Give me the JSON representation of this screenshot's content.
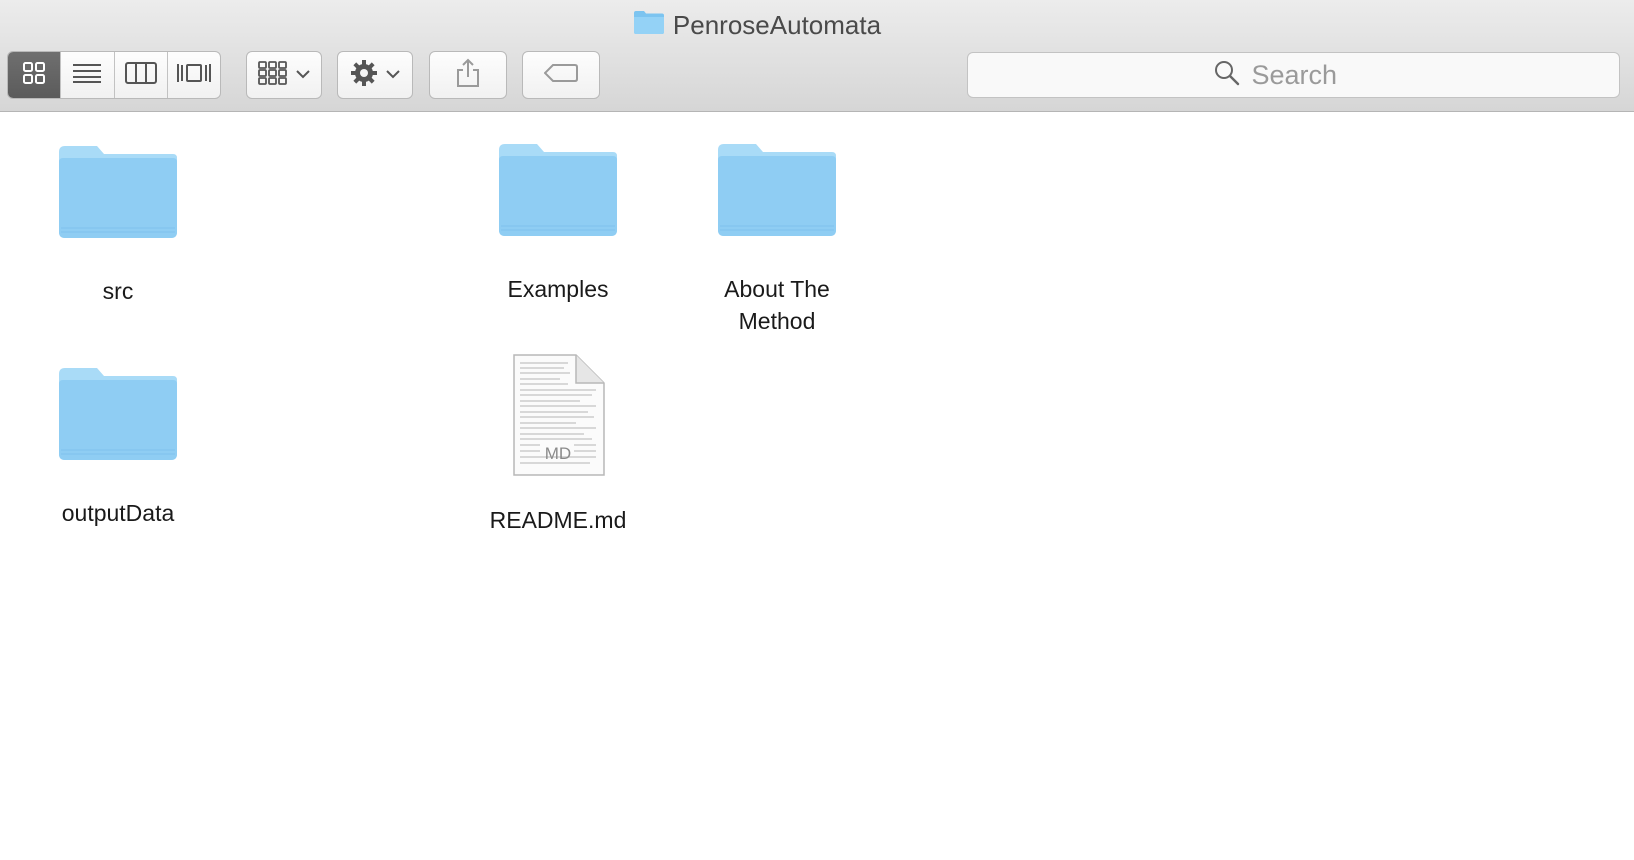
{
  "window": {
    "title": "PenroseAutomata"
  },
  "toolbar": {
    "view_modes": [
      {
        "name": "icon-view",
        "active": true
      },
      {
        "name": "list-view",
        "active": false
      },
      {
        "name": "column-view",
        "active": false
      },
      {
        "name": "cover-flow-view",
        "active": false
      }
    ],
    "arrange_icon": "arrange-icon",
    "action_icon": "gear-icon",
    "share_icon": "share-icon",
    "tag_icon": "tag-icon"
  },
  "search": {
    "placeholder": "Search"
  },
  "items": [
    {
      "kind": "folder",
      "label": "src"
    },
    {
      "kind": "folder",
      "label": "Examples"
    },
    {
      "kind": "folder",
      "label": "About The Method"
    },
    {
      "kind": "folder",
      "label": "outputData"
    },
    {
      "kind": "file",
      "label": "README.md",
      "badge": "MD"
    }
  ],
  "colors": {
    "folder_body": "#8fcdf3",
    "folder_tab": "#a9dbf7",
    "active_segment": "#636363"
  }
}
